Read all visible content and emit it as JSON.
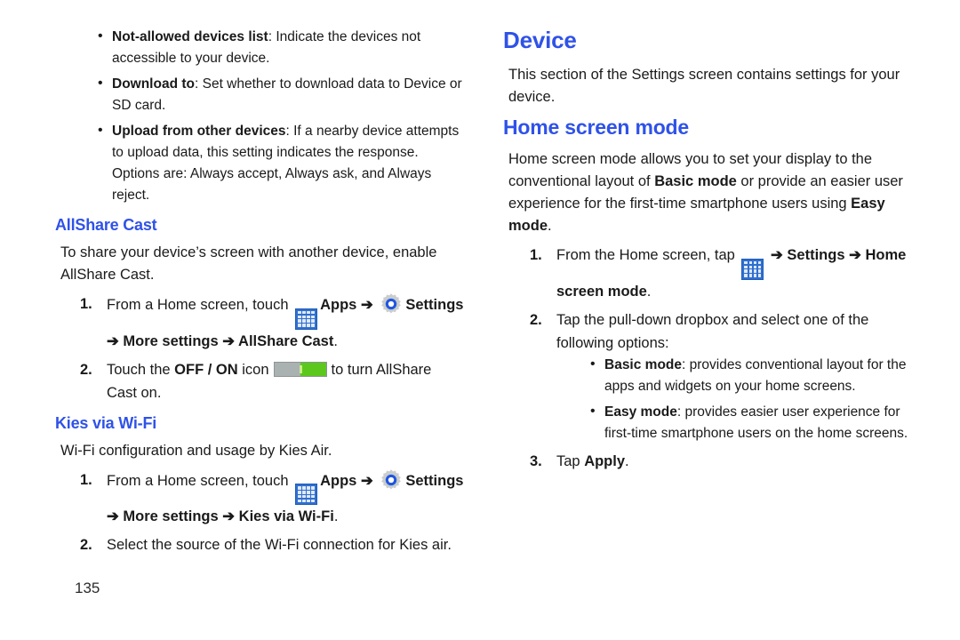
{
  "page": {
    "number": "135"
  },
  "left_column": {
    "top_bullets": [
      {
        "term": "Not-allowed devices list",
        "rest": ": Indicate the devices not accessible to your device."
      },
      {
        "term": "Download to",
        "rest": ": Set whether to download data to Device or SD card."
      },
      {
        "term": "Upload from other devices",
        "rest": ": If a nearby device attempts to upload data, this setting indicates the response. Options are: Always accept, Always ask, and Always reject."
      }
    ],
    "allshare": {
      "heading": "AllShare Cast",
      "intro": "To share your device’s screen with another device, enable AllShare Cast.",
      "step1": {
        "num": "1.",
        "text_before_apps": "From a Home screen, touch",
        "apps_label": "Apps",
        "arrow": "➔",
        "settings_label": "Settings",
        "continuation": "➔ More settings ➔ AllShare Cast",
        "period": "."
      },
      "step2": {
        "num": "2.",
        "text_before_toggle": "Touch the",
        "offon_label": "OFF / ON",
        "icon_word": "icon",
        "text_after_toggle": "to turn AllShare Cast on."
      }
    },
    "kies": {
      "heading": "Kies via Wi-Fi",
      "intro": "Wi-Fi configuration and usage by Kies Air.",
      "step1": {
        "num": "1.",
        "text_before_apps": "From a Home screen, touch",
        "apps_label": "Apps",
        "arrow": "➔",
        "settings_label": "Settings",
        "continuation": "➔ More settings ➔ Kies via Wi-Fi",
        "period": "."
      },
      "step2": {
        "num": "2.",
        "text": "Select the source of the Wi-Fi connection for Kies air."
      }
    }
  },
  "right_column": {
    "device": {
      "heading": "Device",
      "intro": "This section of the Settings screen contains settings for your device."
    },
    "home_screen_mode": {
      "heading": "Home screen mode",
      "intro_part1": "Home screen mode allows you to set your display to the conventional layout of ",
      "intro_bold1": "Basic mode",
      "intro_part2": " or provide an easier user experience for the first-time smartphone users using ",
      "intro_bold2": "Easy mode",
      "intro_part3": ".",
      "step1": {
        "num": "1.",
        "text_before_apps": "From the Home screen, tap",
        "continuation": "➔ Settings ➔ Home screen mode",
        "period": "."
      },
      "step2": {
        "num": "2.",
        "text": "Tap the pull-down dropbox and select one of the following options:",
        "options": [
          {
            "term": "Basic mode",
            "rest": ": provides conventional layout for the apps and widgets on your home screens."
          },
          {
            "term": "Easy mode",
            "rest": ": provides easier user experience for first-time smartphone users on the home screens."
          }
        ]
      },
      "step3": {
        "num": "3.",
        "text_before_bold": "Tap ",
        "bold": "Apply",
        "period": "."
      }
    }
  },
  "colors": {
    "heading_blue": "#2f52e8",
    "apps_icon_blue": "#2f6fd0",
    "toggle_green": "#5cc81e",
    "toggle_gray": "#a9b1b1"
  },
  "icons": {
    "apps": "apps-grid-icon",
    "settings": "gear-icon",
    "toggle": "toggle-switch-icon"
  }
}
